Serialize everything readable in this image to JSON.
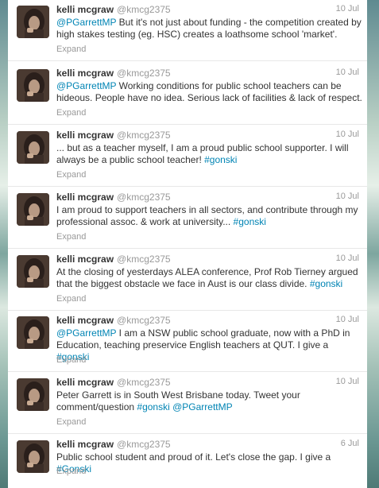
{
  "accent_color": "#0084b4",
  "tweets": [
    {
      "name": "kelli mcgraw",
      "handle": "@kmcg2375",
      "date": "10 Jul",
      "parts": [
        {
          "t": "@PGarrettMP",
          "link": true
        },
        {
          "t": " But it's not just about funding - the competition created by high stakes testing (eg. HSC) creates a loathsome school 'market'.",
          "link": false
        }
      ],
      "expand": "Expand"
    },
    {
      "name": "kelli mcgraw",
      "handle": "@kmcg2375",
      "date": "10 Jul",
      "parts": [
        {
          "t": "@PGarrettMP",
          "link": true
        },
        {
          "t": " Working conditions for public school teachers can be hideous. People have no idea. Serious lack of facilities & lack of respect.",
          "link": false
        }
      ],
      "expand": "Expand"
    },
    {
      "name": "kelli mcgraw",
      "handle": "@kmcg2375",
      "date": "10 Jul",
      "parts": [
        {
          "t": "... but as a teacher myself, I am a proud public school supporter. I will always be a public school teacher! ",
          "link": false
        },
        {
          "t": "#gonski",
          "link": true
        }
      ],
      "expand": "Expand"
    },
    {
      "name": "kelli mcgraw",
      "handle": "@kmcg2375",
      "date": "10 Jul",
      "parts": [
        {
          "t": "I am proud to support teachers in all sectors, and contribute through my professional assoc. & work at university... ",
          "link": false
        },
        {
          "t": "#gonski",
          "link": true
        }
      ],
      "expand": "Expand"
    },
    {
      "name": "kelli mcgraw",
      "handle": "@kmcg2375",
      "date": "10 Jul",
      "parts": [
        {
          "t": "At the closing of yesterdays ALEA conference, Prof Rob Tierney argued that the biggest obstacle we face in Aust is our class divide. ",
          "link": false
        },
        {
          "t": "#gonski",
          "link": true
        }
      ],
      "expand": "Expand"
    },
    {
      "name": "kelli mcgraw",
      "handle": "@kmcg2375",
      "date": "10 Jul",
      "parts": [
        {
          "t": "@PGarrettMP",
          "link": true
        },
        {
          "t": " I am a NSW public school graduate, now with a PhD in Education, teaching preservice English teachers at QUT. I give a ",
          "link": false
        },
        {
          "t": "#gonski",
          "link": true
        }
      ],
      "expand": "Expand"
    },
    {
      "name": "kelli mcgraw",
      "handle": "@kmcg2375",
      "date": "10 Jul",
      "parts": [
        {
          "t": "Peter Garrett is in South West Brisbane today. Tweet your comment/question ",
          "link": false
        },
        {
          "t": "#gonski",
          "link": true
        },
        {
          "t": " ",
          "link": false
        },
        {
          "t": "@PGarrettMP",
          "link": true
        }
      ],
      "expand": "Expand"
    },
    {
      "name": "kelli mcgraw",
      "handle": "@kmcg2375",
      "date": "6 Jul",
      "parts": [
        {
          "t": "Public school student and proud of it. Let's close the gap. I give a ",
          "link": false
        },
        {
          "t": "#Gonski",
          "link": true
        }
      ],
      "expand": "Expand"
    }
  ]
}
